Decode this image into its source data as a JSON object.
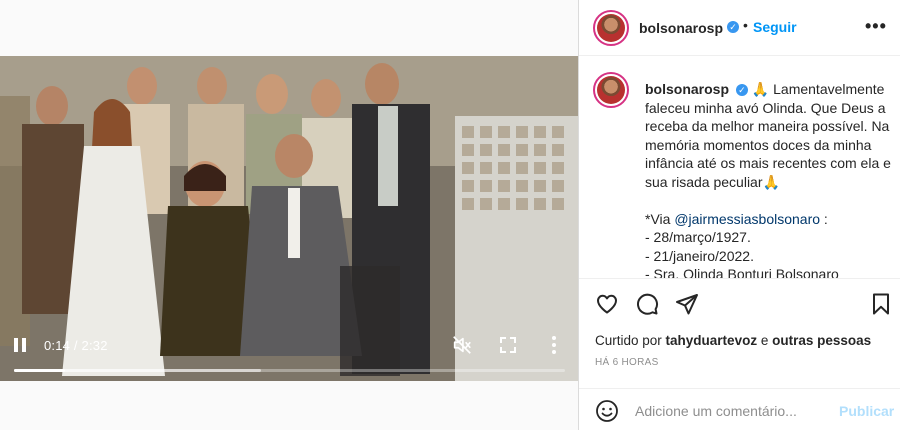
{
  "post": {
    "username": "bolsonarosp",
    "verified_glyph": "✓",
    "dot": "•",
    "follow_label": "Seguir",
    "more_glyph": "•••"
  },
  "video": {
    "current_time": "0:14",
    "duration": "2:32",
    "time_display": "0:14 / 2:32",
    "progress": 0.092,
    "buffered": 0.448,
    "playing": true,
    "muted": true
  },
  "caption": {
    "username": "bolsonarosp",
    "emoji_pray": "🙏",
    "line1": "Lamentavelmente",
    "line2": "faleceu minha avó Olinda. Que Deus a",
    "line3": "receba da melhor maneira possível. Na",
    "line4": "memória momentos doces da minha",
    "line5": "infância até os mais recentes com ela e",
    "line6": "sua risada peculiar",
    "via_prefix": "*Via ",
    "via_mention": "@jairmessiasbolsonaro",
    "via_suffix": " :",
    "item1": "- 28/março/1927.",
    "item2": "- 21/janeiro/2022.",
    "item3": "- Sra. Olinda Bonturi Bolsonaro"
  },
  "actions": {
    "like_icon": "heart-icon",
    "comment_icon": "comment-icon",
    "share_icon": "share-icon",
    "save_icon": "bookmark-icon"
  },
  "likes": {
    "prefix": "Curtido por ",
    "user": "tahyduartevoz",
    "connector": " e ",
    "others": "outras pessoas"
  },
  "time_ago": "HÁ 6 HORAS",
  "comment": {
    "placeholder": "Adicione um comentário...",
    "publish_label": "Publicar"
  },
  "colors": {
    "accent": "#0095f6",
    "publish_disabled": "#b2dffc",
    "verified": "#3897f0"
  }
}
